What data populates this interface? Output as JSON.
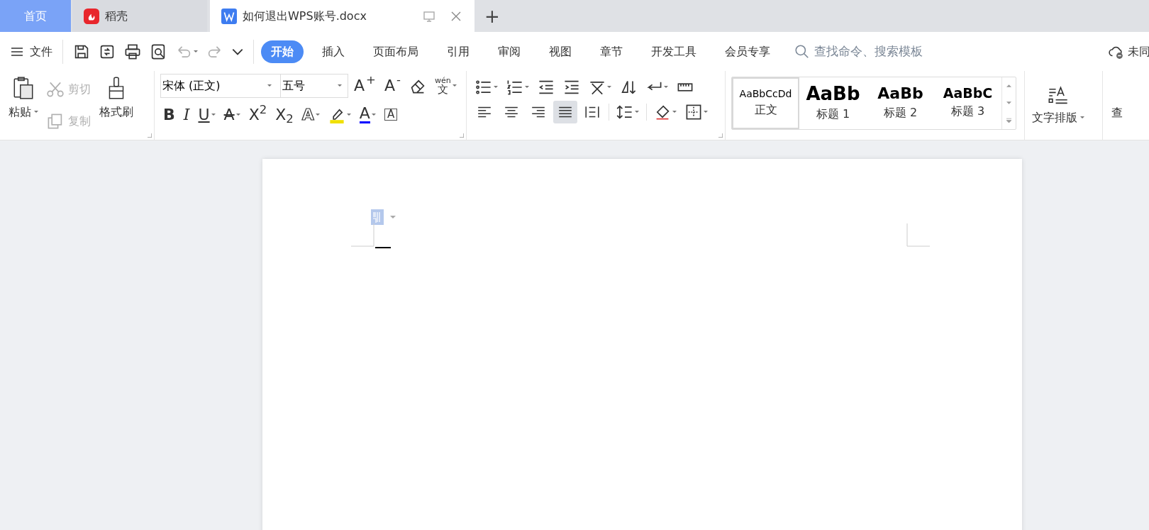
{
  "tabs": [
    {
      "label": "首页",
      "kind": "home",
      "selected": false
    },
    {
      "label": "稻壳",
      "kind": "app",
      "selected": false
    },
    {
      "label": "如何退出WPS账号.docx",
      "kind": "doc",
      "selected": true
    }
  ],
  "new_tab": "+",
  "menu": {
    "file": "文件",
    "quick_access": [
      {
        "disabled": false
      },
      {
        "disabled": false
      },
      {
        "disabled": false
      },
      {
        "disabled": false
      },
      {
        "disabled": true
      },
      {
        "disabled": true
      },
      {
        "disabled": false
      }
    ],
    "ribbon_tabs": [
      {
        "label": "开始",
        "selected": true
      },
      {
        "label": "插入",
        "selected": false
      },
      {
        "label": "页面布局",
        "selected": false
      },
      {
        "label": "引用",
        "selected": false
      },
      {
        "label": "审阅",
        "selected": false
      },
      {
        "label": "视图",
        "selected": false
      },
      {
        "label": "章节",
        "selected": false
      },
      {
        "label": "开发工具",
        "selected": false
      },
      {
        "label": "会员专享",
        "selected": false
      }
    ],
    "search": {
      "placeholder": "查找命令、搜索模板"
    },
    "sync": "未同"
  },
  "clipboard": {
    "paste": "粘贴",
    "cut": {
      "label": "剪切",
      "disabled": true
    },
    "copy": {
      "label": "复制",
      "disabled": true
    },
    "painter": "格式刷"
  },
  "font": {
    "name": "宋体 (正文)",
    "size": "五号",
    "size_buttons": [
      "A$^{+}$",
      "A$^{-}$"
    ],
    "pinyin": {
      "top": "wén",
      "base": "文"
    },
    "format_buttons": [
      {
        "kind": "bold",
        "glyph": "B"
      },
      {
        "kind": "italic",
        "glyph": "I"
      },
      {
        "kind": "underline",
        "glyph": "U"
      },
      {
        "kind": "strike",
        "glyph": "A"
      },
      {
        "kind": "plain",
        "glyph": "X$^{2}$"
      },
      {
        "kind": "plain",
        "glyph": "X$_{2}$"
      },
      {
        "kind": "outline",
        "glyph": "A"
      },
      {
        "kind": "highlight",
        "color": "#f0e000"
      },
      {
        "kind": "color",
        "glyph": "A",
        "color": "#0000ff"
      },
      {
        "kind": "boxed",
        "glyph": "A"
      }
    ]
  },
  "paragraph": {
    "alignment": [
      {
        "selected": false
      },
      {
        "selected": false
      },
      {
        "selected": false
      },
      {
        "selected": true
      },
      {
        "selected": false
      }
    ]
  },
  "styles": [
    {
      "preview": "AaBbCcDd",
      "label": "正文",
      "kind": "normal",
      "selected": true
    },
    {
      "preview": "AaBb",
      "label": "标题 1",
      "kind": "h1",
      "selected": false
    },
    {
      "preview": "AaBb",
      "label": "标题 2",
      "kind": "h2",
      "selected": false
    },
    {
      "preview": "AaBbC",
      "label": "标题 3",
      "kind": "h3",
      "selected": false
    }
  ],
  "layout_button": "文字排版",
  "cut_off_label": "查"
}
